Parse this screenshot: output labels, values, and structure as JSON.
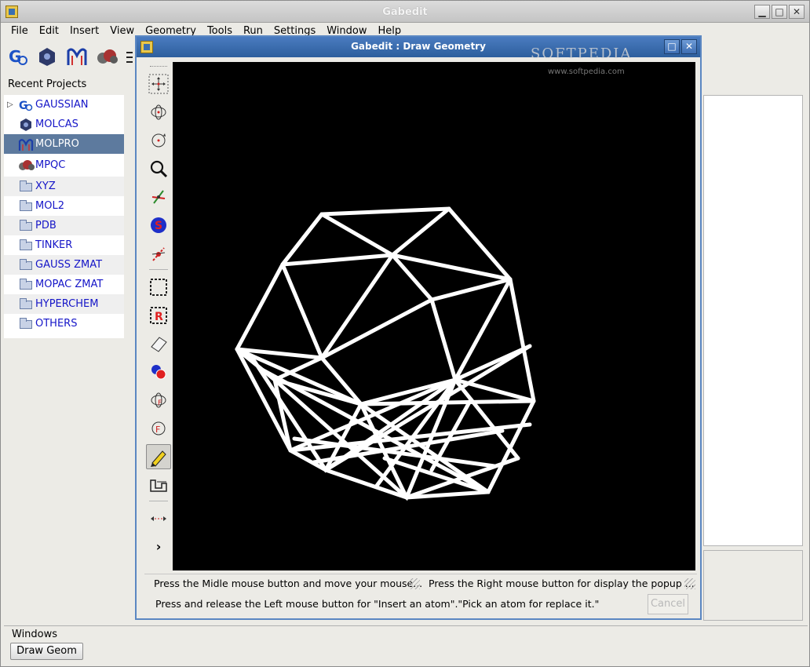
{
  "app": {
    "title": "Gabedit"
  },
  "menu": [
    "File",
    "Edit",
    "Insert",
    "View",
    "Geometry",
    "Tools",
    "Run",
    "Settings",
    "Window",
    "Help"
  ],
  "recent": {
    "label": "Recent Projects",
    "items": [
      {
        "label": "GAUSSIAN",
        "icon": "gaussian-icon",
        "arrow": true
      },
      {
        "label": "MOLCAS",
        "icon": "molcas-icon"
      },
      {
        "label": "MOLPRO",
        "icon": "molpro-icon",
        "selected": true
      },
      {
        "label": "MPQC",
        "icon": "mpqc-icon"
      },
      {
        "label": "XYZ",
        "icon": "folder-icon"
      },
      {
        "label": "MOL2",
        "icon": "folder-icon"
      },
      {
        "label": "PDB",
        "icon": "folder-icon"
      },
      {
        "label": "TINKER",
        "icon": "folder-icon"
      },
      {
        "label": "GAUSS ZMAT",
        "icon": "folder-icon"
      },
      {
        "label": "MOPAC ZMAT",
        "icon": "folder-icon"
      },
      {
        "label": "HYPERCHEM",
        "icon": "folder-icon"
      },
      {
        "label": "OTHERS",
        "icon": "folder-icon"
      }
    ]
  },
  "windows": {
    "label": "Windows",
    "button": "Draw Geom"
  },
  "dialog": {
    "title": "Gabedit : Draw Geometry",
    "status_left": "Press the Midle mouse button and move your mouse...",
    "status_right": "Press the Right mouse button for display the popup ...",
    "status_bottom": "Press and release the Left mouse button for \"Insert an atom\".\"Pick an atom for replace it.\"",
    "cancel": "Cancel",
    "tools": [
      "translate-icon",
      "rotate-icon",
      "rotate-z-icon",
      "zoom-icon",
      "bond-icon",
      "s-icon",
      "measure-icon",
      "select-box-icon",
      "select-residue-icon",
      "eraser-icon",
      "atoms-icon",
      "frag-rotate-icon",
      "frag-icon",
      "pencil-icon",
      "add-fragment-icon",
      "distance-icon",
      "more-icon"
    ]
  },
  "watermark": {
    "brand": "SOFTPEDIA",
    "url": "www.softpedia.com"
  },
  "colors": {
    "accent": "#2d5f9d",
    "selected": "#5d7a9e",
    "link": "#1515c8"
  }
}
